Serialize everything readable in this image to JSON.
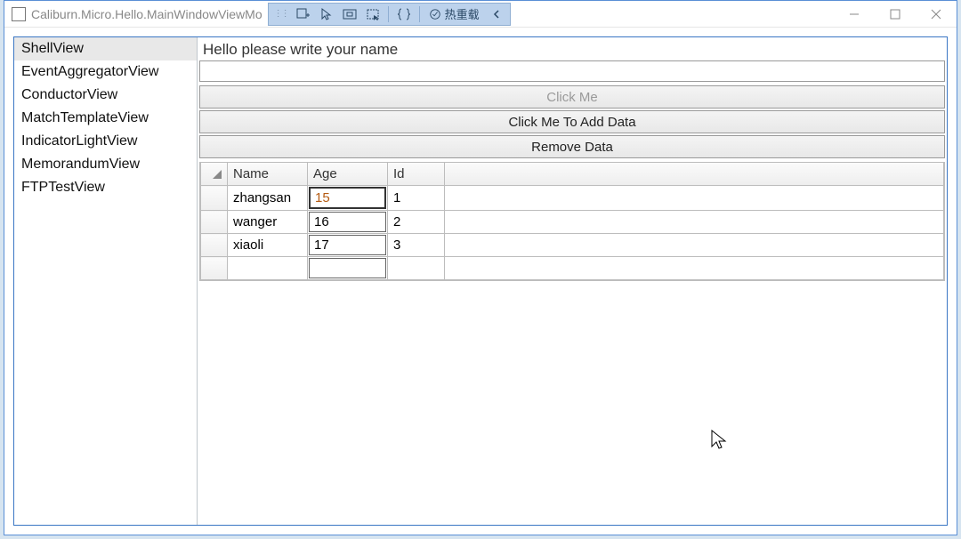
{
  "window": {
    "title": "Caliburn.Micro.Hello.MainWindowViewMo"
  },
  "debugToolbar": {
    "hotReload": "热重载"
  },
  "sidebar": {
    "items": [
      {
        "label": "ShellView",
        "selected": true
      },
      {
        "label": "EventAggregatorView",
        "selected": false
      },
      {
        "label": "ConductorView",
        "selected": false
      },
      {
        "label": "MatchTemplateView",
        "selected": false
      },
      {
        "label": "IndicatorLightView",
        "selected": false
      },
      {
        "label": "MemorandumView",
        "selected": false
      },
      {
        "label": "FTPTestView",
        "selected": false
      }
    ]
  },
  "main": {
    "prompt": "Hello please write your name",
    "nameValue": "",
    "buttons": {
      "clickMe": "Click Me",
      "addData": "Click Me To Add Data",
      "removeData": "Remove Data"
    },
    "grid": {
      "headers": {
        "name": "Name",
        "age": "Age",
        "id": "Id"
      },
      "rows": [
        {
          "name": "zhangsan",
          "age": "15",
          "id": "1",
          "ageEditing": true
        },
        {
          "name": "wanger",
          "age": "16",
          "id": "2",
          "ageEditing": false
        },
        {
          "name": "xiaoli",
          "age": "17",
          "id": "3",
          "ageEditing": false
        }
      ]
    }
  }
}
